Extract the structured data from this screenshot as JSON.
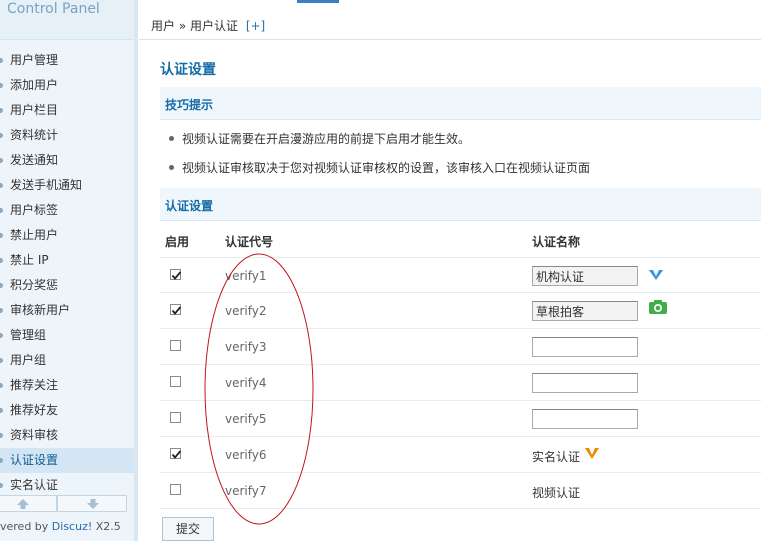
{
  "sidebar": {
    "logo": "Control Panel",
    "items": [
      {
        "label": "用户管理"
      },
      {
        "label": "添加用户"
      },
      {
        "label": "用户栏目"
      },
      {
        "label": "资料统计"
      },
      {
        "label": "发送通知"
      },
      {
        "label": "发送手机通知"
      },
      {
        "label": "用户标签"
      },
      {
        "label": "禁止用户"
      },
      {
        "label": "禁止 IP"
      },
      {
        "label": "积分奖惩"
      },
      {
        "label": "审核新用户"
      },
      {
        "label": "管理组"
      },
      {
        "label": "用户组"
      },
      {
        "label": "推荐关注"
      },
      {
        "label": "推荐好友"
      },
      {
        "label": "资料审核"
      },
      {
        "label": "认证设置",
        "active": true
      },
      {
        "label": "实名认证"
      }
    ],
    "powered_prefix": "vered by ",
    "powered_brand": "Discuz!",
    "powered_version": " X2.5"
  },
  "header": {
    "breadcrumb": "用户 » 用户认证",
    "add_label": "[+]"
  },
  "main": {
    "title": "认证设置",
    "tips_title": "技巧提示",
    "tips": [
      "视频认证需要在开启漫游应用的前提下启用才能生效。",
      "视频认证审核取决于您对视频认证审核权的设置，该审核入口在视频认证页面"
    ],
    "section_title": "认证设置",
    "columns": {
      "enabled": "启用",
      "code": "认证代号",
      "name": "认证名称"
    },
    "rows": [
      {
        "enabled": true,
        "code": "verify1",
        "name": "机构认证",
        "editable": true,
        "icon": "v-blue-icon"
      },
      {
        "enabled": true,
        "code": "verify2",
        "name": "草根拍客",
        "editable": true,
        "icon": "camera-green-icon"
      },
      {
        "enabled": false,
        "code": "verify3",
        "name": "",
        "editable": true
      },
      {
        "enabled": false,
        "code": "verify4",
        "name": "",
        "editable": true
      },
      {
        "enabled": false,
        "code": "verify5",
        "name": "",
        "editable": true
      },
      {
        "enabled": true,
        "code": "verify6",
        "name": "实名认证",
        "editable": false,
        "icon": "v-orange-icon"
      },
      {
        "enabled": false,
        "code": "verify7",
        "name": "视频认证",
        "editable": false
      }
    ],
    "submit_label": "提交"
  },
  "colors": {
    "accent": "#146ba8",
    "annotation": "#c0151b"
  }
}
